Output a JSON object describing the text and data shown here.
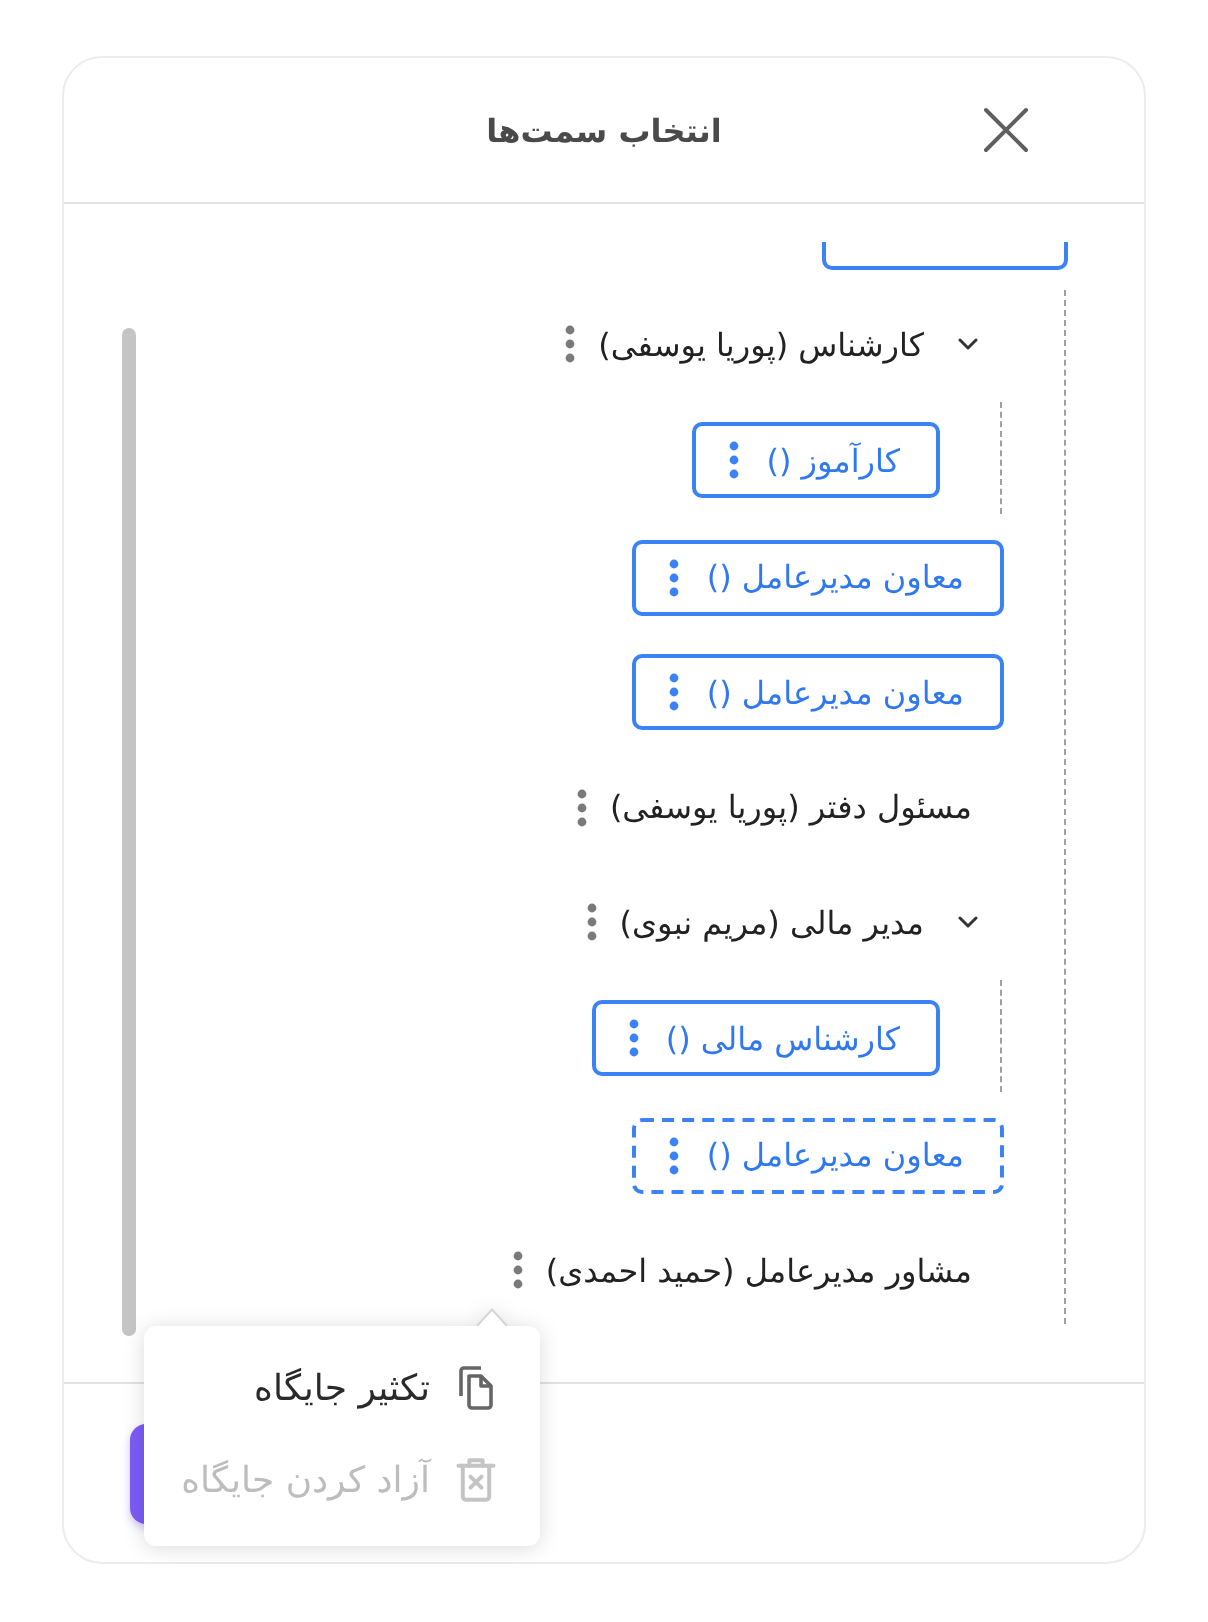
{
  "dialog": {
    "title": "انتخاب سمت‌ها"
  },
  "tree": {
    "root": {
      "cut_off": true,
      "children": [
        {
          "kind": "person",
          "label": "کارشناس (پوریا یوسفی)",
          "expanded": true,
          "children": [
            {
              "kind": "vacant",
              "label": "کارآموز ()",
              "dashed": false
            }
          ]
        },
        {
          "kind": "vacant",
          "label": "معاون مدیرعامل ()",
          "dashed": false
        },
        {
          "kind": "vacant",
          "label": "معاون مدیرعامل ()",
          "dashed": false
        },
        {
          "kind": "person",
          "label": "مسئول دفتر (پوریا یوسفی)"
        },
        {
          "kind": "person",
          "label": "مدیر مالی (مریم نبوی)",
          "expanded": true,
          "children": [
            {
              "kind": "vacant",
              "label": "کارشناس مالی ()",
              "dashed": false
            }
          ]
        },
        {
          "kind": "vacant",
          "label": "معاون مدیرعامل ()",
          "dashed": true
        },
        {
          "kind": "person",
          "label": "مشاور مدیرعامل (حمید احمدی)"
        }
      ]
    }
  },
  "context_menu": {
    "items": [
      {
        "kind": "copy",
        "label": "تکثیر جایگاه",
        "disabled": false
      },
      {
        "kind": "delete",
        "label": "آزاد کردن جایگاه",
        "disabled": true
      }
    ]
  }
}
